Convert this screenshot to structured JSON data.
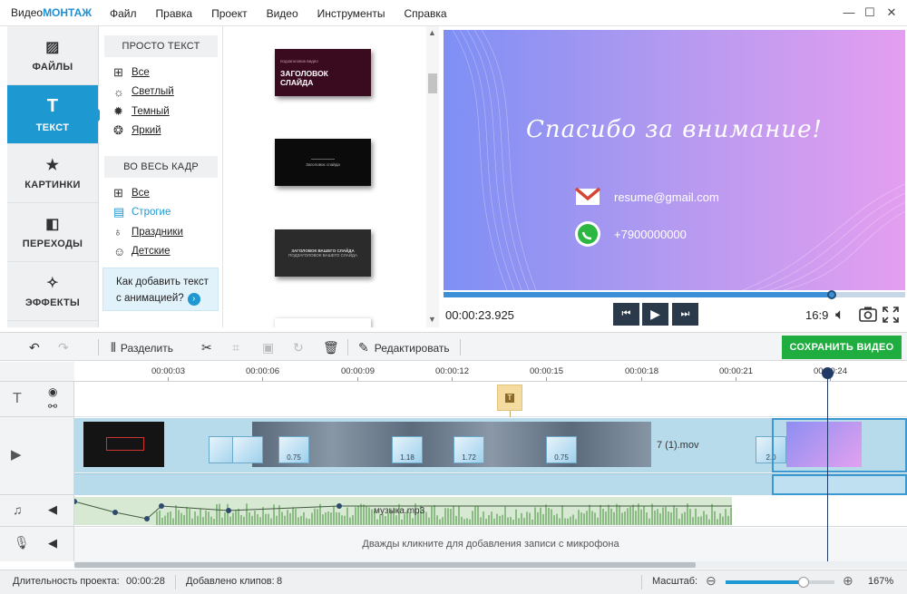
{
  "app": {
    "logo_a": "Видео",
    "logo_b": "МОНТАЖ"
  },
  "menu": [
    "Файл",
    "Правка",
    "Проект",
    "Видео",
    "Инструменты",
    "Справка"
  ],
  "window_controls": [
    "—",
    "☐",
    "✕"
  ],
  "tabs": [
    {
      "label": "ФАЙЛЫ",
      "icon": "image-icon"
    },
    {
      "label": "ТЕКСТ",
      "icon": "text-t-icon",
      "active": true
    },
    {
      "label": "КАРТИНКИ",
      "icon": "star-icon"
    },
    {
      "label": "ПЕРЕХОДЫ",
      "icon": "squares-icon"
    },
    {
      "label": "ЭФФЕКТЫ",
      "icon": "magic-wand-icon"
    }
  ],
  "categories": {
    "group1": "ПРОСТО ТЕКСТ",
    "group1_items": [
      "Все",
      "Светлый",
      "Темный",
      "Яркий"
    ],
    "group2": "ВО ВЕСЬ КАДР",
    "group2_items": [
      "Все",
      "Строгие",
      "Праздники",
      "Детские"
    ],
    "selected": "Строгие",
    "help_line1": "Как добавить текст",
    "help_line2": "с анимацией?",
    "help_icon": "›"
  },
  "gallery": [
    {
      "small": "подзаголовок видео",
      "big1": "ЗАГОЛОВОК",
      "big2": "СЛАЙДА",
      "bg": "#3a0a1e"
    },
    {
      "small": "Заголовок слайда",
      "big1": "",
      "big2": "",
      "bg": "#0b0b0b"
    },
    {
      "small": "",
      "big1": "ЗАГОЛОВОК ВАШЕГО СЛАЙДА",
      "big2": "ПОДЗАГОЛОВОК ВАШЕГО СЛАЙДА",
      "bg": "#2b2b2b"
    }
  ],
  "preview": {
    "title": "Спасибо за внимание!",
    "email": "resume@gmail.com",
    "phone": "+7900000000"
  },
  "player": {
    "timecode": "00:00:23.925",
    "progress": 0.84,
    "ratio": "16:9"
  },
  "toolbar": {
    "split": "Разделить",
    "edit": "Редактировать",
    "save": "СОХРАНИТЬ ВИДЕО"
  },
  "timeline": {
    "ticks": [
      "00:00:03",
      "00:00:06",
      "00:00:09",
      "00:00:12",
      "00:00:15",
      "00:00:18",
      "00:00:21",
      "00:00:24"
    ],
    "video_clip_name": "7 (1).mov",
    "transitions": [
      "0.75",
      "1.18",
      "1.72",
      "0.75",
      "2.0"
    ],
    "audio_name": "музыка.mp3",
    "mic_hint": "Дважды кликните для добавления записи с микрофона",
    "playhead_time": "00:00:24"
  },
  "status": {
    "duration_label": "Длительность проекта:",
    "duration_value": "00:00:28",
    "clips_label": "Добавлено клипов:",
    "clips_value": "8",
    "zoom_label": "Масштаб:",
    "zoom_value": "167%",
    "zoom_level": 0.72
  },
  "colors": {
    "accent": "#1d98d1",
    "save": "#1fad3f"
  }
}
